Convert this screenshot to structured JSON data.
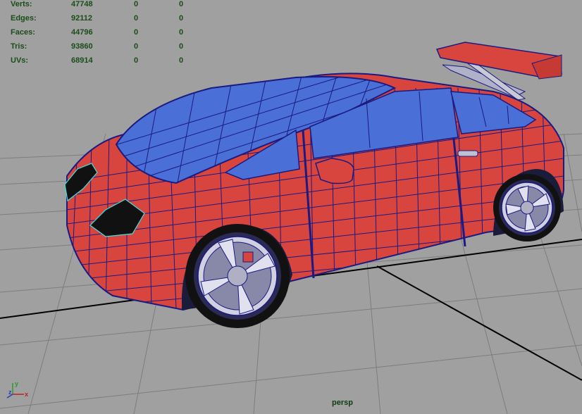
{
  "viewport": {
    "camera": "persp",
    "background": "#a0a0a0",
    "accent_body_color": "#d8453f",
    "glass_color": "#4a6fd6",
    "wire_color": "#1a1a80",
    "selection_color": "#40e0e0"
  },
  "hud": {
    "rows": [
      {
        "label": "Verts:",
        "v1": "47748",
        "v2": "0",
        "v3": "0"
      },
      {
        "label": "Edges:",
        "v1": "92112",
        "v2": "0",
        "v3": "0"
      },
      {
        "label": "Faces:",
        "v1": "44796",
        "v2": "0",
        "v3": "0"
      },
      {
        "label": "Tris:",
        "v1": "93860",
        "v2": "0",
        "v3": "0"
      },
      {
        "label": "UVs:",
        "v1": "68914",
        "v2": "0",
        "v3": "0"
      }
    ]
  },
  "axis": {
    "z": "z",
    "y": "y",
    "x": "x"
  }
}
